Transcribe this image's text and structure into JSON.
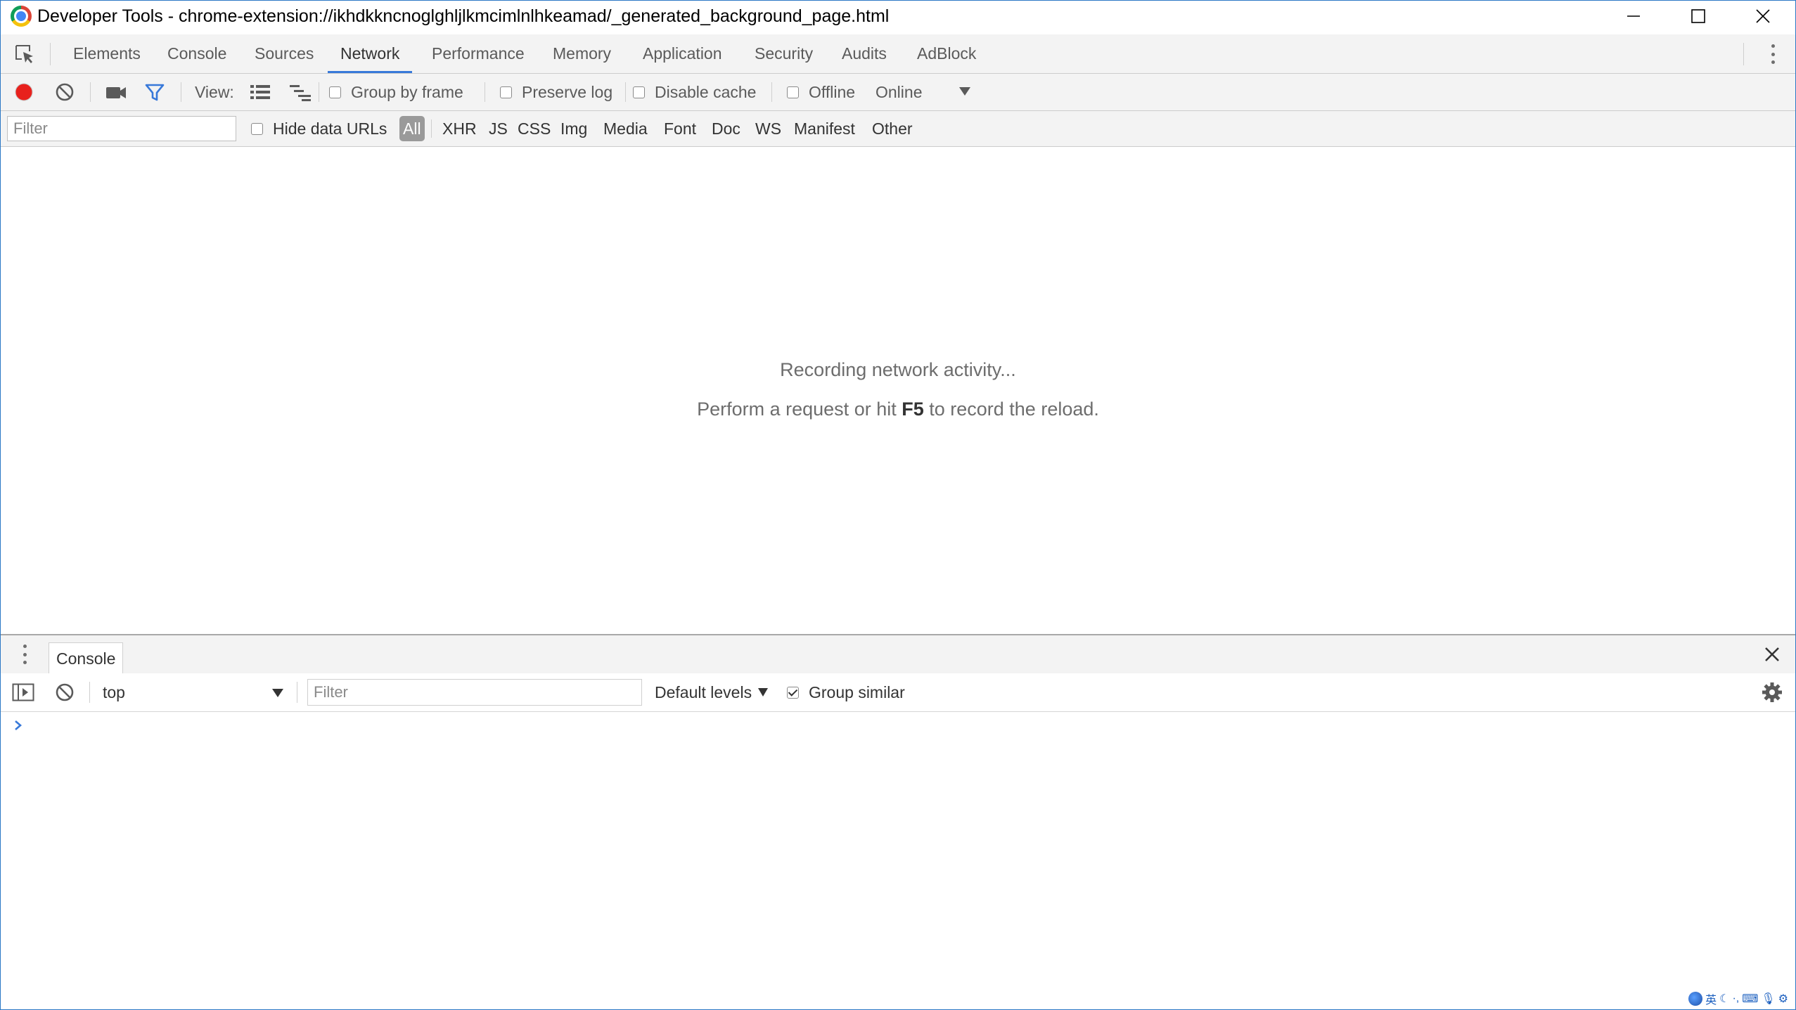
{
  "window": {
    "title": "Developer Tools - chrome-extension://ikhdkkncnoglghljlkmcimlnlhkeamad/_generated_background_page.html"
  },
  "tabs": [
    {
      "label": "Elements"
    },
    {
      "label": "Console"
    },
    {
      "label": "Sources"
    },
    {
      "label": "Network",
      "active": true
    },
    {
      "label": "Performance"
    },
    {
      "label": "Memory"
    },
    {
      "label": "Application"
    },
    {
      "label": "Security"
    },
    {
      "label": "Audits"
    },
    {
      "label": "AdBlock"
    }
  ],
  "network_toolbar": {
    "view_label": "View:",
    "group_by_frame": {
      "label": "Group by frame",
      "checked": false
    },
    "preserve_log": {
      "label": "Preserve log",
      "checked": false
    },
    "disable_cache": {
      "label": "Disable cache",
      "checked": false
    },
    "offline": {
      "label": "Offline",
      "checked": false
    },
    "throttling": "Online",
    "record_color": "#e8211d",
    "filter_icon_color": "#3879d9"
  },
  "filter_bar": {
    "placeholder": "Filter",
    "hide_data_urls": {
      "label": "Hide data URLs",
      "checked": false
    },
    "types": [
      "All",
      "XHR",
      "JS",
      "CSS",
      "Img",
      "Media",
      "Font",
      "Doc",
      "WS",
      "Manifest",
      "Other"
    ],
    "active_type": "All"
  },
  "empty_state": {
    "line1": "Recording network activity...",
    "line2_before": "Perform a request or hit ",
    "line2_key": "F5",
    "line2_after": " to record the reload."
  },
  "drawer": {
    "tab_label": "Console",
    "context": "top",
    "filter_placeholder": "Filter",
    "levels": "Default levels",
    "group_similar": {
      "label": "Group similar",
      "checked": true
    }
  },
  "tray": {
    "ime_text": "英"
  }
}
